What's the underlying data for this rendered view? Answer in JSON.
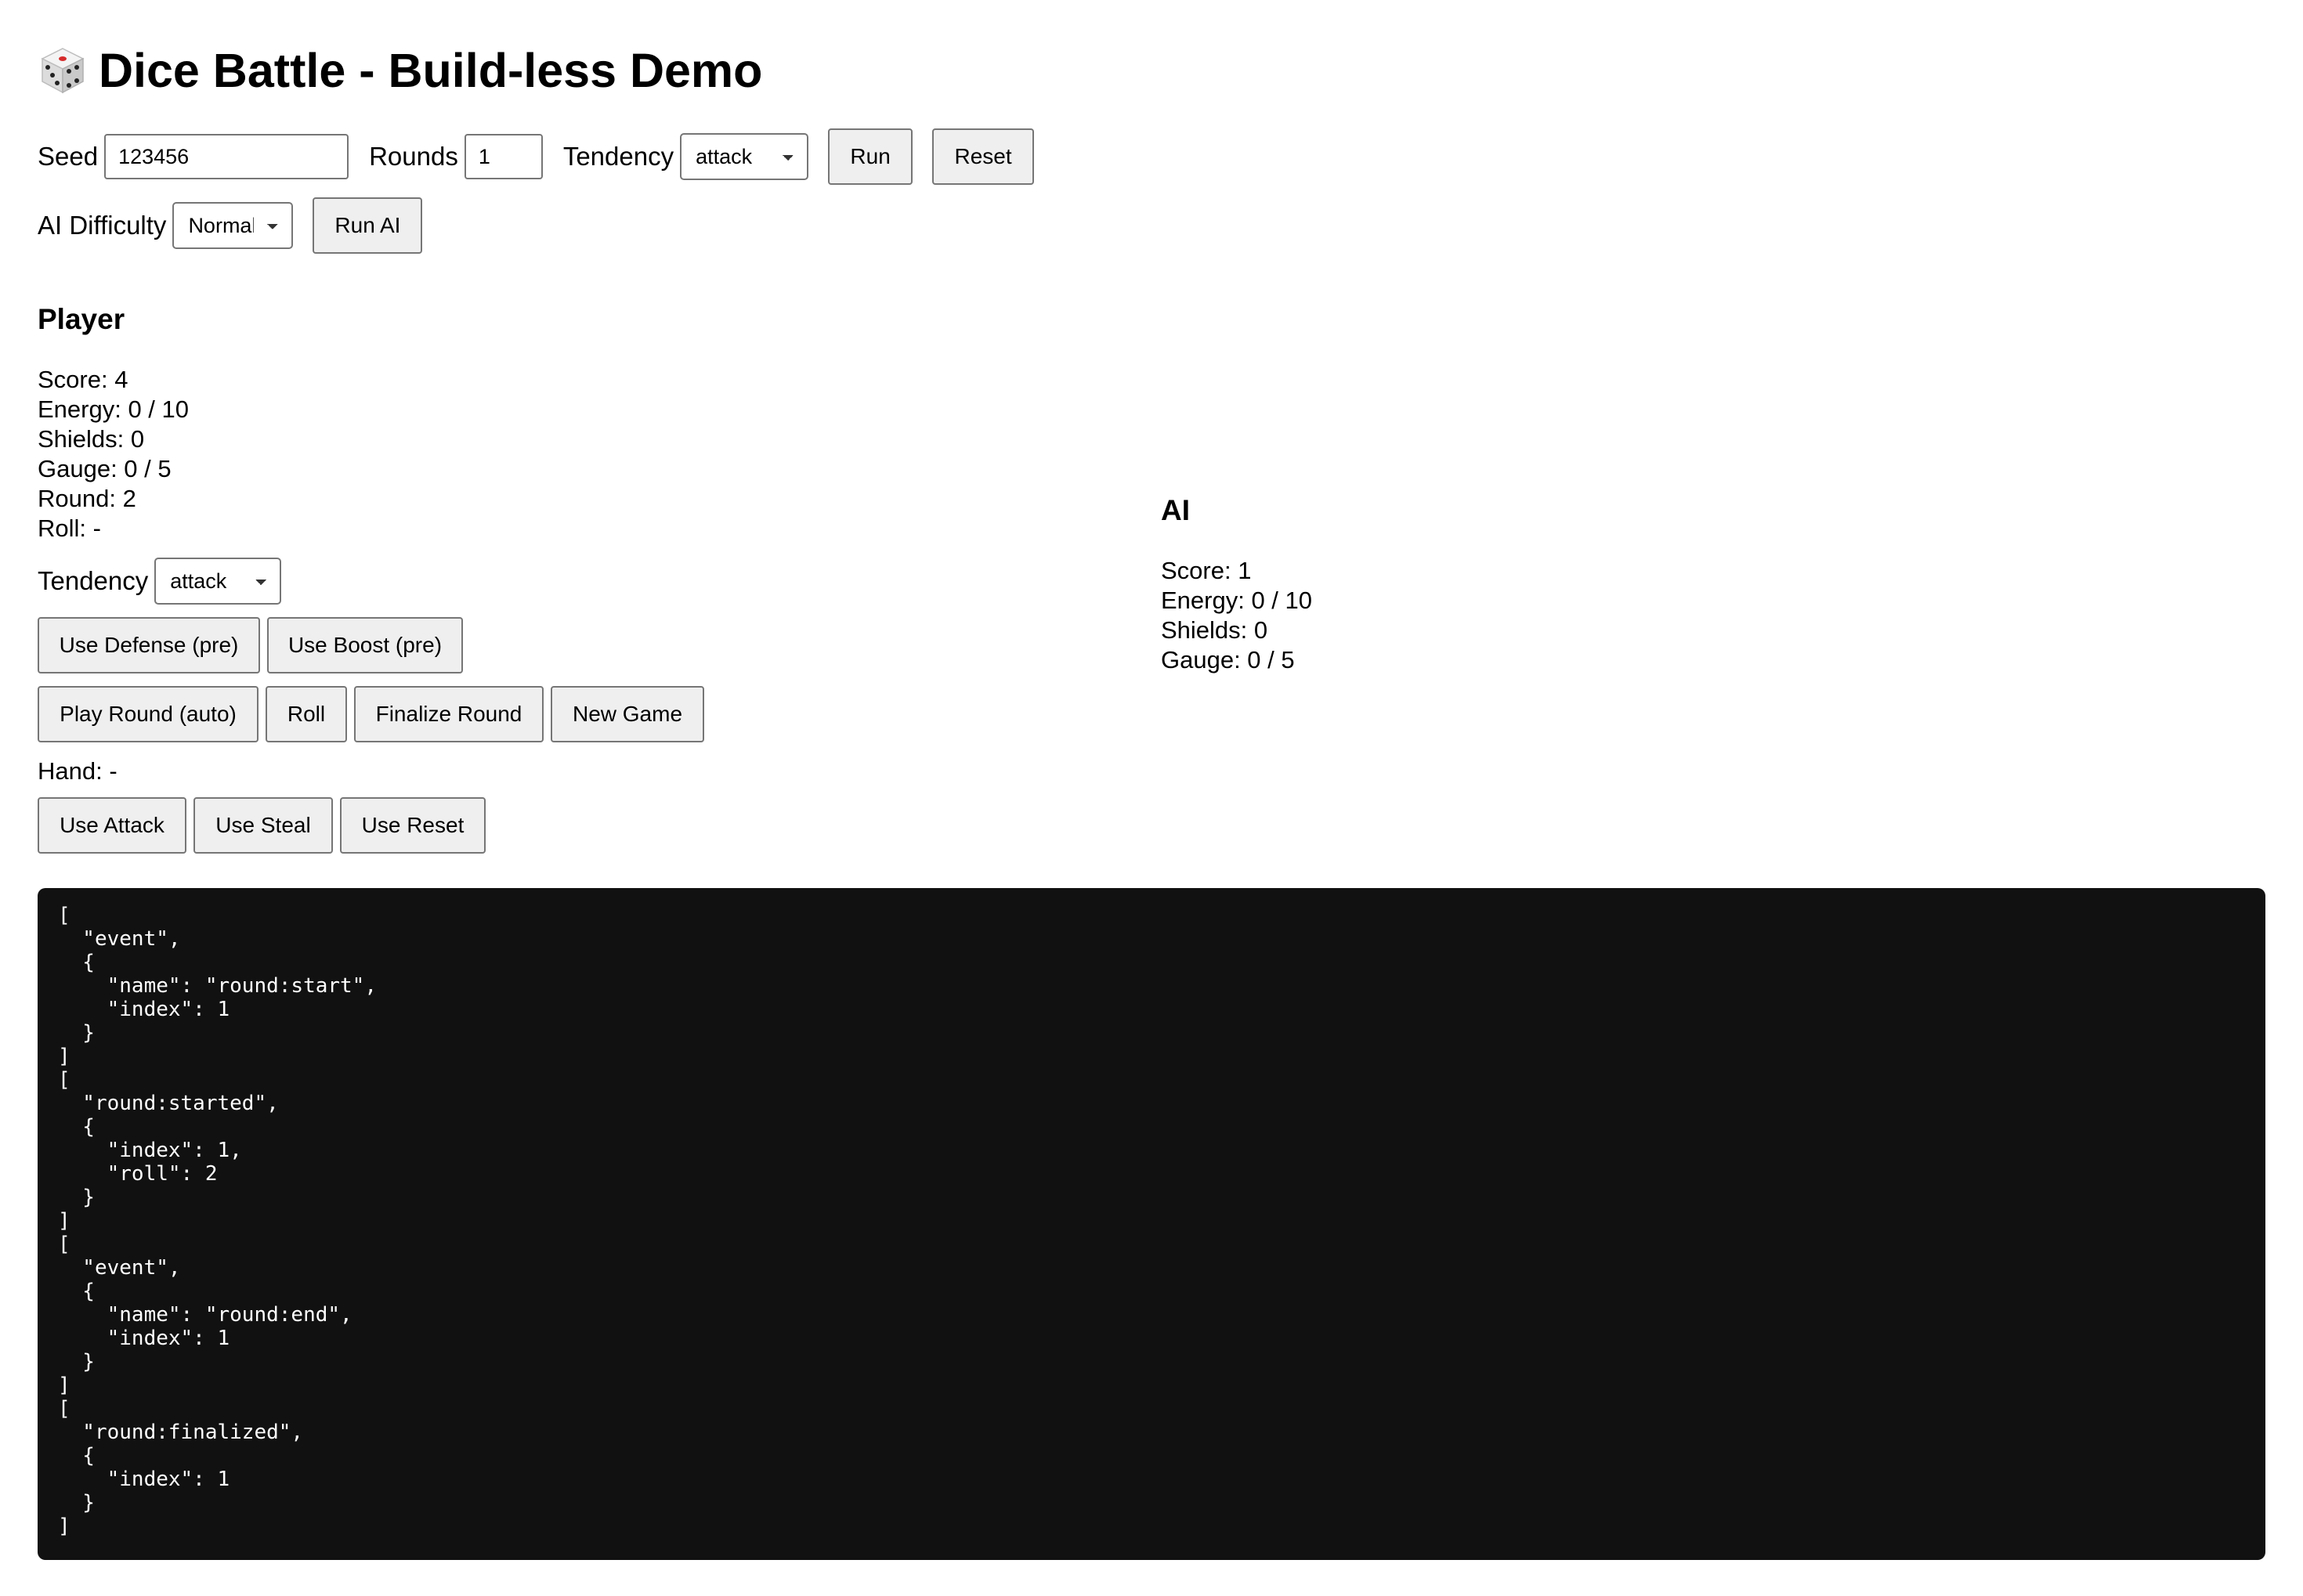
{
  "header": {
    "title": "Dice Battle - Build-less Demo",
    "icon": "dice-icon"
  },
  "controls": {
    "seed_label": "Seed",
    "seed_value": "123456",
    "rounds_label": "Rounds",
    "rounds_value": "1",
    "tendency_label": "Tendency",
    "tendency_value": "attack",
    "run_label": "Run",
    "reset_label": "Reset",
    "ai_difficulty_label": "AI Difficulty",
    "ai_difficulty_value": "Normal",
    "run_ai_label": "Run AI"
  },
  "player": {
    "heading": "Player",
    "score": "Score: 4",
    "energy": "Energy: 0 / 10",
    "shields": "Shields: 0",
    "gauge": "Gauge: 0 / 5",
    "round": "Round: 2",
    "roll": "Roll: -",
    "tendency_label": "Tendency",
    "tendency_value": "attack",
    "use_defense_label": "Use Defense (pre)",
    "use_boost_label": "Use Boost (pre)",
    "play_round_label": "Play Round (auto)",
    "roll_label": "Roll",
    "finalize_label": "Finalize Round",
    "new_game_label": "New Game",
    "hand": "Hand: -",
    "use_attack_label": "Use Attack",
    "use_steal_label": "Use Steal",
    "use_reset_label": "Use Reset"
  },
  "ai": {
    "heading": "AI",
    "score": "Score: 1",
    "energy": "Energy: 0 / 10",
    "shields": "Shields: 0",
    "gauge": "Gauge: 0 / 5"
  },
  "log": {
    "text": "[\n  \"event\",\n  {\n    \"name\": \"round:start\",\n    \"index\": 1\n  }\n]\n[\n  \"round:started\",\n  {\n    \"index\": 1,\n    \"roll\": 2\n  }\n]\n[\n  \"event\",\n  {\n    \"name\": \"round:end\",\n    \"index\": 1\n  }\n]\n[\n  \"round:finalized\",\n  {\n    \"index\": 1\n  }\n]"
  },
  "colors": {
    "log_background": "#111111",
    "log_text": "#ffffff",
    "button_background": "#efefef"
  }
}
